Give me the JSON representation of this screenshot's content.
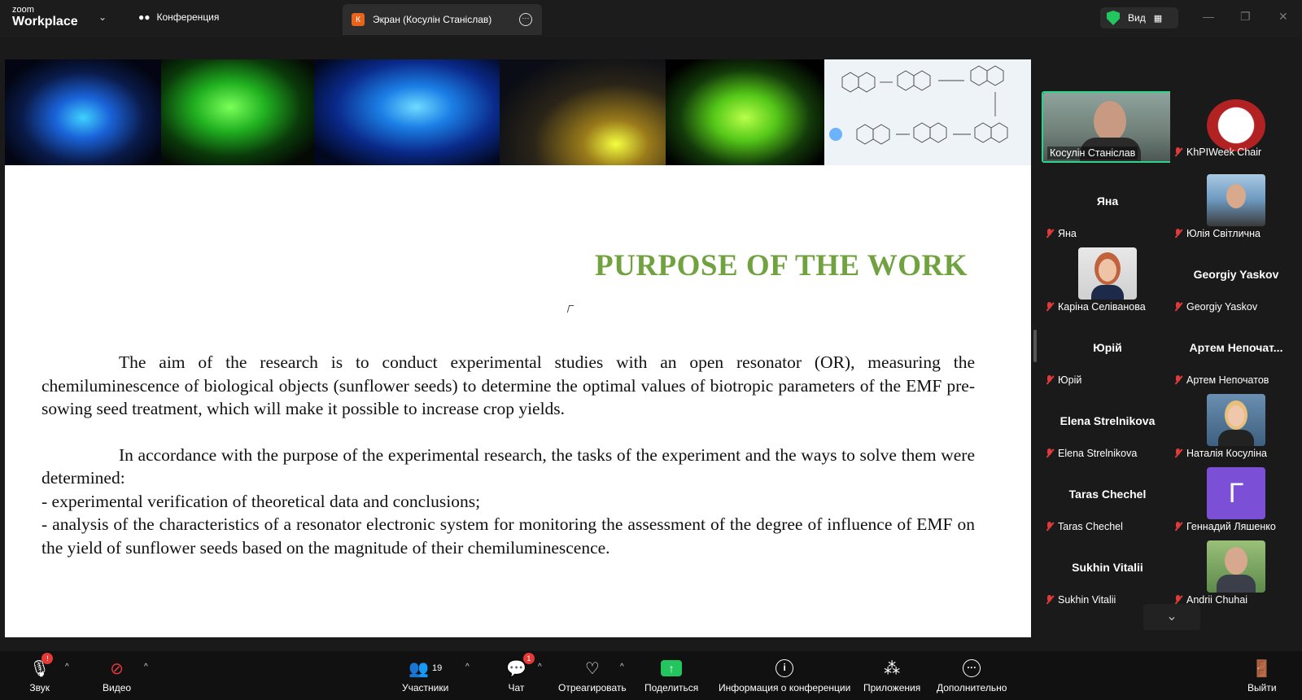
{
  "app": {
    "logo_top": "zoom",
    "logo_bottom": "Workplace"
  },
  "tabs": {
    "conference": "Конференция",
    "screen": "Экран (Косулін Станіслав)",
    "screen_initial": "К"
  },
  "view": {
    "label": "Вид"
  },
  "slide": {
    "title": "PURPOSE OF THE WORK",
    "para1": "The aim of the research is to conduct experimental studies with an open resonator (OR), measuring the chemiluminescence of biological objects (sunflower seeds) to determine the optimal values of biotropic parameters of the EMF pre-sowing seed treatment, which will make it possible to increase crop yields.",
    "para2": "In accordance with the purpose of the experimental research, the tasks of the experiment and the ways to solve them were determined:",
    "bullet1": " - experimental verification of theoretical data and conclusions;",
    "bullet2": " - analysis of the characteristics of a resonator electronic system for monitoring the assessment of the degree of influence of EMF on the yield of sunflower seeds based on the magnitude of their chemiluminescence."
  },
  "participants": [
    {
      "label": "Косулін Станіслав",
      "big": ""
    },
    {
      "label": "KhPIWeek Chair",
      "big": ""
    },
    {
      "label": "Яна",
      "big": "Яна"
    },
    {
      "label": "Юлія Світлична",
      "big": ""
    },
    {
      "label": "Каріна Селіванова",
      "big": ""
    },
    {
      "label": "Georgiy Yaskov",
      "big": "Georgiy Yaskov"
    },
    {
      "label": "Юрій",
      "big": "Юрій"
    },
    {
      "label": "Артем Непочатов",
      "big": "Артем  Непочат..."
    },
    {
      "label": "Elena Strelnikova",
      "big": "Elena Strelnikova"
    },
    {
      "label": "Наталія Косуліна",
      "big": ""
    },
    {
      "label": "Taras Chechel",
      "big": "Taras Chechel"
    },
    {
      "label": "Геннадий Ляшенко",
      "big": "",
      "avatar": "Г"
    },
    {
      "label": "Sukhin Vitalii",
      "big": "Sukhin Vitalii"
    },
    {
      "label": "Andrii Chuhai",
      "big": ""
    }
  ],
  "toolbar": {
    "audio": "Звук",
    "video": "Видео",
    "participants": "Участники",
    "participants_count": "19",
    "chat": "Чат",
    "chat_badge": "1",
    "react": "Отреагировать",
    "share": "Поделиться",
    "info": "Информация о конференции",
    "apps": "Приложения",
    "more": "Дополнительно",
    "leave": "Выйти"
  },
  "colors": {
    "title_green": "#70a33f",
    "active_border": "#2fd18b",
    "mute_red": "#e03a3a",
    "share_green": "#22c55e"
  }
}
